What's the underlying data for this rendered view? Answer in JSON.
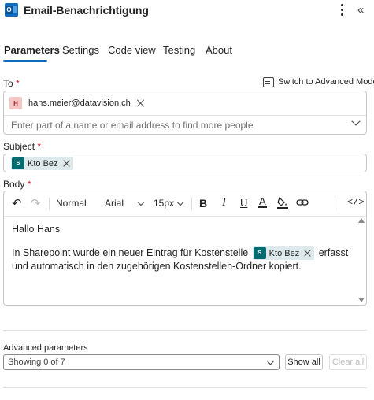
{
  "header": {
    "app_icon_letter": "O",
    "title": "Email-Benachrichtigung"
  },
  "tabs": [
    {
      "label": "Parameters",
      "active": true
    },
    {
      "label": "Settings",
      "active": false
    },
    {
      "label": "Code view",
      "active": false
    },
    {
      "label": "Testing",
      "active": false
    },
    {
      "label": "About",
      "active": false
    }
  ],
  "to": {
    "label": "To",
    "required_mark": "*",
    "switch_label": "Switch to Advanced Mode",
    "recipient_initial": "H",
    "recipient_email": "hans.meier@datavision.ch",
    "placeholder": "Enter part of a name or email address to find more people"
  },
  "subject": {
    "label": "Subject",
    "required_mark": "*",
    "token_icon": "S",
    "token_label": "Kto Bez"
  },
  "body": {
    "label": "Body",
    "required_mark": "*",
    "toolbar": {
      "paragraph_style": "Normal",
      "font": "Arial",
      "font_size": "15px",
      "bold": "B",
      "italic": "I",
      "underline": "U",
      "font_color": "A",
      "code_view": "</>"
    },
    "greeting": "Hallo Hans",
    "text_before": "In Sharepoint wurde ein neuer Eintrag für Kostenstelle",
    "token_icon": "S",
    "token_label": "Kto Bez",
    "text_after": "erfasst und automatisch in den zugehörigen Kostenstellen-Ordner kopiert."
  },
  "advanced": {
    "label": "Advanced parameters",
    "select_value": "Showing 0 of 7",
    "show_all": "Show all",
    "clear_all": "Clear all"
  }
}
